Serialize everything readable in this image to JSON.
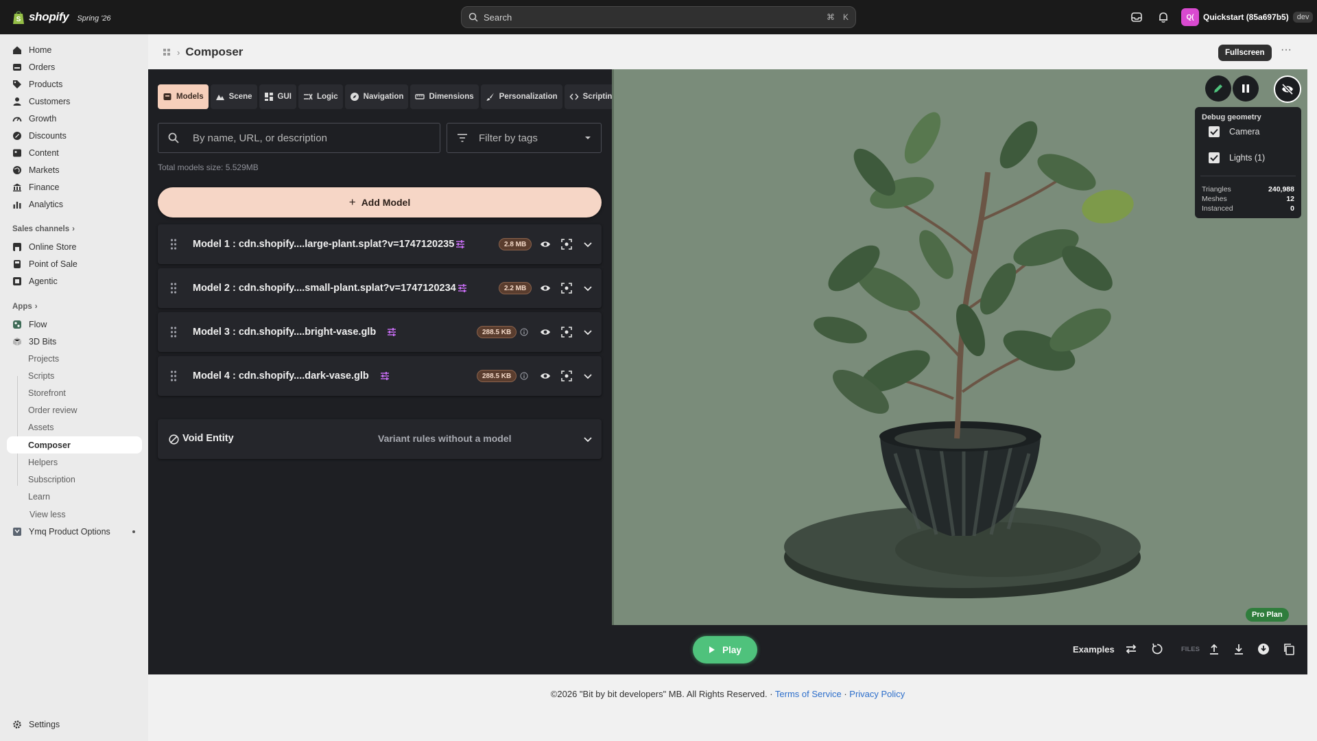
{
  "topbar": {
    "brand": "shopify",
    "season": "Spring '26",
    "search_placeholder": "Search",
    "shortcut_cmd": "⌘",
    "shortcut_key": "K",
    "store_initials": "Q(",
    "store_name": "Quickstart (85a697b5)",
    "store_badge": "dev"
  },
  "sidebar": {
    "main": [
      "Home",
      "Orders",
      "Products",
      "Customers",
      "Growth",
      "Discounts",
      "Content",
      "Markets",
      "Finance",
      "Analytics"
    ],
    "sales_channels_label": "Sales channels",
    "sales_channels": [
      "Online Store",
      "Point of Sale",
      "Agentic"
    ],
    "apps_label": "Apps",
    "apps": [
      "Flow",
      "3D Bits"
    ],
    "app_sub": [
      "Projects",
      "Scripts",
      "Storefront",
      "Order review",
      "Assets",
      "Composer",
      "Helpers",
      "Subscription",
      "Learn"
    ],
    "view_less": "View less",
    "extra_app": "Ymq Product Options",
    "settings": "Settings"
  },
  "page": {
    "title": "Composer",
    "fullscreen_label": "Fullscreen",
    "more_label": "···"
  },
  "composer": {
    "tabs": [
      "Models",
      "Scene",
      "GUI",
      "Logic",
      "Navigation",
      "Dimensions",
      "Personalization",
      "Scripting"
    ],
    "search_placeholder": "By name, URL, or description",
    "filter_placeholder": "Filter by tags",
    "total_size": "Total models size: 5.529MB",
    "add_model_label": "Add Model",
    "models": [
      {
        "name": "Model 1 : cdn.shopify....large-plant.splat?v=1747120235",
        "size": "2.8 MB"
      },
      {
        "name": "Model 2 : cdn.shopify....small-plant.splat?v=1747120234",
        "size": "2.2 MB"
      },
      {
        "name": "Model 3 : cdn.shopify....bright-vase.glb",
        "size": "288.5 KB"
      },
      {
        "name": "Model 4 : cdn.shopify....dark-vase.glb",
        "size": "288.5 KB"
      }
    ],
    "void_entity": {
      "title": "Void Entity",
      "subtitle": "Variant rules without a model"
    }
  },
  "viewport": {
    "debug_title": "Debug geometry",
    "camera_label": "Camera",
    "lights_label": "Lights (1)",
    "stats": [
      {
        "label": "Triangles",
        "value": "240,988"
      },
      {
        "label": "Meshes",
        "value": "12"
      },
      {
        "label": "Instanced",
        "value": "0"
      }
    ],
    "pro_plan": "Pro Plan"
  },
  "bottombar": {
    "play_label": "Play",
    "examples_label": "Examples",
    "files_label": "FILES"
  },
  "footer": {
    "copyright": "©2026 \"Bit by bit developers\" MB. All Rights Reserved. · ",
    "terms": "Terms of Service",
    "sep": " · ",
    "privacy": "Privacy Policy"
  },
  "colors": {
    "accent_peach": "#f6cfbb",
    "play_green": "#4fc27c",
    "tune_purple": "#c46cf0",
    "viewport_bg": "#7a8c7a"
  }
}
